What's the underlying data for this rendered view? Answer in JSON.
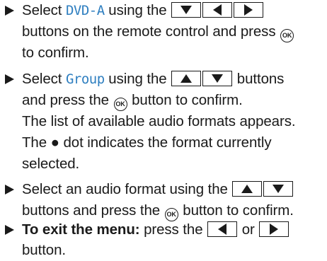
{
  "steps": [
    {
      "lines": [
        {
          "pre": "Select ",
          "kw": "DVD-A",
          "post": " using the "
        },
        {
          "t1": "buttons on the remote control and press "
        },
        {
          "t1": "to confirm."
        }
      ]
    },
    {
      "lines": [
        {
          "pre": "Select ",
          "kw": "Group",
          "post": " using the ",
          "post2": " buttons"
        },
        {
          "t1": "and press the ",
          "t2": " button to confirm."
        },
        {
          "t1": "The list of available audio formats appears."
        },
        {
          "t1": "The ● dot indicates the format currently"
        },
        {
          "t1": "selected."
        }
      ]
    },
    {
      "lines": [
        {
          "t1": "Select an audio format using the "
        },
        {
          "t1": "buttons and press the ",
          "t2": " button to confirm."
        }
      ]
    },
    {
      "lines": [
        {
          "bold": "To exit the menu:",
          "t1": " press the ",
          "t2": " or "
        },
        {
          "t1": "button."
        }
      ]
    }
  ],
  "ok_label": "OK",
  "colors": {
    "keyword": "#2f7fc0",
    "text": "#1a1a1a"
  }
}
